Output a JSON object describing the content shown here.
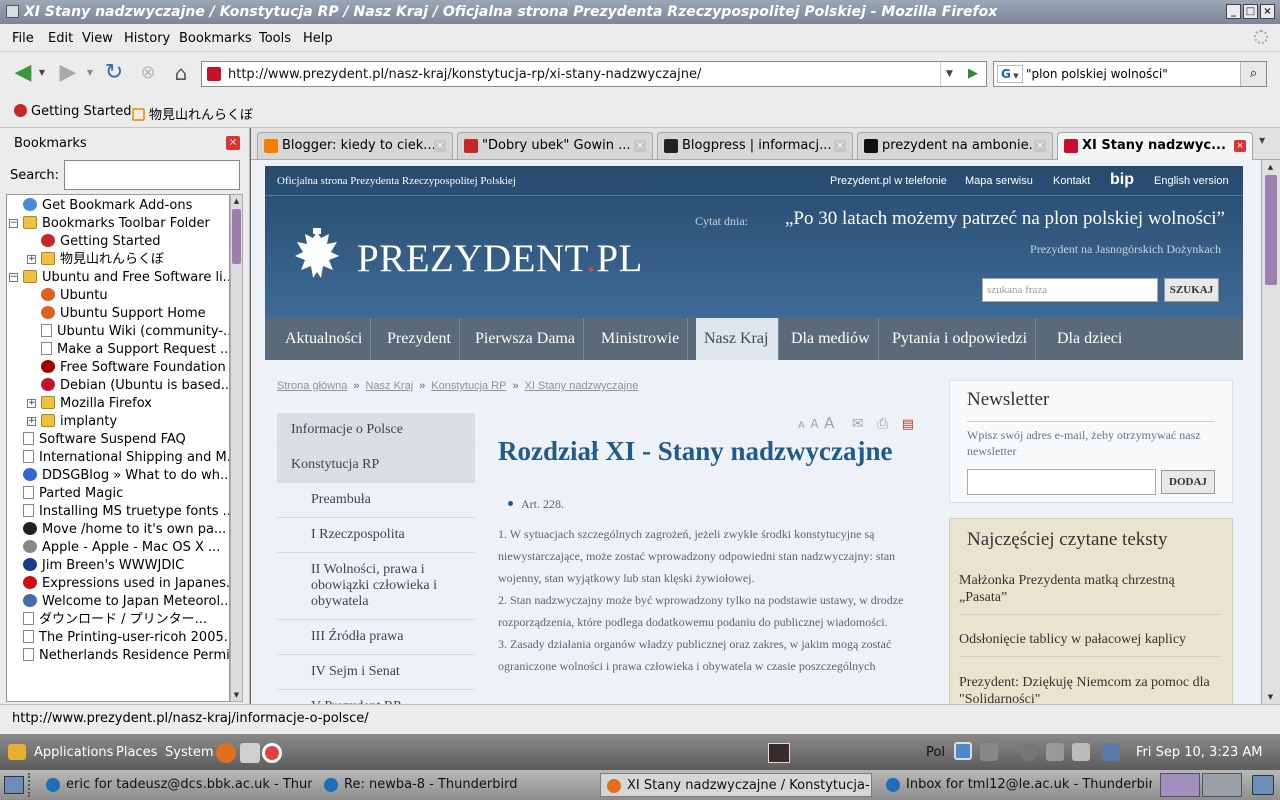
{
  "window": {
    "title": "XI Stany nadzwyczajne / Konstytucja RP / Nasz Kraj / Oficjalna strona Prezydenta Rzeczypospolitej Polskiej - Mozilla Firefox"
  },
  "menubar": [
    "File",
    "Edit",
    "View",
    "History",
    "Bookmarks",
    "Tools",
    "Help"
  ],
  "navbar": {
    "url": "http://www.prezydent.pl/nasz-kraj/konstytucja-rp/xi-stany-nadzwyczajne/",
    "search_engine": "G",
    "search_value": "\"plon  polskiej  wolności\""
  },
  "bookmarks_toolbar": [
    "Getting Started",
    "物見山れんらくぼ"
  ],
  "sidebar": {
    "title": "Bookmarks",
    "search_label": "Search:",
    "items": [
      {
        "label": "Get Bookmark Add-ons",
        "icon": "addons-icon",
        "level": 0
      },
      {
        "label": "Bookmarks Toolbar Folder",
        "icon": "folder-icon",
        "level": 0,
        "twisty": "−"
      },
      {
        "label": "Getting Started",
        "icon": "firefox-icon",
        "level": 1
      },
      {
        "label": "物見山れんらくぼ",
        "icon": "folder-icon",
        "level": 1,
        "twisty": "+"
      },
      {
        "label": "Ubuntu and Free Software li...",
        "icon": "folder-icon",
        "level": 0,
        "twisty": "−"
      },
      {
        "label": "Ubuntu",
        "icon": "ubuntu-icon",
        "level": 1
      },
      {
        "label": "Ubuntu Support Home",
        "icon": "ubuntu-icon",
        "level": 1
      },
      {
        "label": "Ubuntu Wiki (community-...",
        "icon": "page-icon",
        "level": 1
      },
      {
        "label": "Make a Support Request ...",
        "icon": "page-icon",
        "level": 1
      },
      {
        "label": "Free Software Foundation",
        "icon": "fsf-icon",
        "level": 1
      },
      {
        "label": "Debian (Ubuntu is based...",
        "icon": "debian-icon",
        "level": 1
      },
      {
        "label": "Mozilla Firefox",
        "icon": "folder-icon",
        "level": 1,
        "twisty": "+"
      },
      {
        "label": "implanty",
        "icon": "folder-icon",
        "level": 1,
        "twisty": "+"
      },
      {
        "label": "Software Suspend FAQ",
        "icon": "page-icon",
        "level": 0
      },
      {
        "label": "International Shipping and M...",
        "icon": "page-icon",
        "level": 0
      },
      {
        "label": "DDSGBlog » What to do wh...",
        "icon": "google-icon",
        "level": 0
      },
      {
        "label": "Parted Magic",
        "icon": "page-icon",
        "level": 0
      },
      {
        "label": "Installing MS truetype fonts ...",
        "icon": "page-icon",
        "level": 0
      },
      {
        "label": "Move /home to it's own pa...",
        "icon": "wordpress-icon",
        "level": 0
      },
      {
        "label": "Apple - Apple - Mac OS X ...",
        "icon": "apple-icon",
        "level": 0
      },
      {
        "label": "Jim Breen's WWWJDIC",
        "icon": "wwwjdic-icon",
        "level": 0
      },
      {
        "label": "Expressions used in Japanes...",
        "icon": "red-dot-icon",
        "level": 0
      },
      {
        "label": "Welcome to Japan Meteorol...",
        "icon": "jma-icon",
        "level": 0
      },
      {
        "label": "ダウンロード / プリンター...",
        "icon": "page-icon",
        "level": 0
      },
      {
        "label": "The Printing-user-ricoh 2005...",
        "icon": "page-icon",
        "level": 0
      },
      {
        "label": "Netherlands Residence Permi...",
        "icon": "page-icon",
        "level": 0
      }
    ]
  },
  "tabs": [
    {
      "label": "Blogger: kiedy to ciek...",
      "favicon_color": "#f57d00",
      "active": false
    },
    {
      "label": "\"Dobry ubek\" Gowin ...",
      "favicon_color": "#c62828",
      "active": false
    },
    {
      "label": "Blogpress | informacj...",
      "favicon_color": "#222222",
      "active": false
    },
    {
      "label": "prezydent na ambonie...",
      "favicon_color": "#111111",
      "active": false
    },
    {
      "label": "XI Stany nadzwyc...",
      "favicon_color": "#c8102e",
      "active": true
    }
  ],
  "site": {
    "top_left": "Oficjalna strona Prezydenta Rzeczypospolitej Polskiej",
    "top_links": [
      "Prezydent.pl w telefonie",
      "Mapa serwisu",
      "Kontakt",
      "bip",
      "English version"
    ],
    "logo_main": "PREZYDENT",
    "logo_dot": ".",
    "logo_suffix": "PL",
    "quote_label": "Cytat dnia:",
    "quote": "„Po 30 latach możemy patrzeć na plon polskiej wolności”",
    "quote_source": "Prezydent na Jasnogórskich Dożynkach",
    "search_placeholder": "szukana fraza",
    "search_button": "SZUKAJ",
    "nav": [
      "Aktualności",
      "Prezydent",
      "Pierwsza Dama",
      "Ministrowie",
      "Nasz Kraj",
      "Dla mediów",
      "Pytania i odpowiedzi",
      "Dla dzieci"
    ],
    "nav_active": "Nasz Kraj",
    "breadcrumb": [
      "Strona główna",
      "Nasz Kraj",
      "Konstytucja RP",
      "XI Stany nadzwyczajne"
    ],
    "breadcrumb_sep": "»",
    "left_nav": {
      "top": [
        "Informacje o Polsce",
        "Konstytucja RP"
      ],
      "sub": [
        "Preambuła",
        "I Rzeczpospolita",
        "II Wolności, prawa i obowiązki człowieka i obywatela",
        "III Źródła prawa",
        "IV Sejm i Senat",
        "V Prezydent RP"
      ]
    },
    "tools": {
      "font_sizes": [
        "A",
        "A",
        "A"
      ]
    },
    "article": {
      "title": "Rozdział XI - Stany nadzwyczajne",
      "bullet": "Art. 228.",
      "paragraphs": [
        "1. W sytuacjach szczególnych zagrożeń, jeżeli zwykłe środki konstytucyjne są niewystarczające, może zostać wprowadzony odpowiedni stan nadzwyczajny: stan wojenny, stan wyjątkowy lub stan klęski żywiołowej.",
        "2. Stan nadzwyczajny może być wprowadzony tylko na podstawie ustawy, w drodze rozporządzenia, które podlega dodatkowemu podaniu do publicznej wiadomości.",
        "3. Zasady działania organów władzy publicznej oraz zakres, w jakim mogą zostać ograniczone wolności i prawa człowieka i obywatela w czasie poszczególnych"
      ]
    },
    "newsletter": {
      "title": "Newsletter",
      "description": "Wpisz swój adres e-mail, żeby otrzymywać nasz newsletter",
      "button": "DODAJ"
    },
    "popular": {
      "title": "Najczęściej czytane teksty",
      "items": [
        "Małżonka Prezydenta matką chrzestną „Pasata”",
        "Odsłonięcie tablicy w pałacowej kaplicy",
        "Prezydent: Dziękuję Niemcom za pomoc dla \"Solidarności\""
      ]
    }
  },
  "statusbar": {
    "text": "http://www.prezydent.pl/nasz-kraj/informacje-o-polsce/"
  },
  "top_panel": {
    "menus": [
      "Applications",
      "Places",
      "System"
    ],
    "keyboard": "Pol",
    "datetime": "Fri Sep 10,  3:23 AM"
  },
  "taskbar": [
    {
      "label": "eric for tadeusz@dcs.bbk.ac.uk - Thun-",
      "active": false
    },
    {
      "label": "Re: newba-8 - Thunderbird",
      "active": false
    },
    {
      "label": "XI Stany nadzwyczajne / Konstytucja-",
      "active": true
    },
    {
      "label": "Inbox for tml12@le.ac.uk - Thunderbird",
      "active": false
    }
  ]
}
